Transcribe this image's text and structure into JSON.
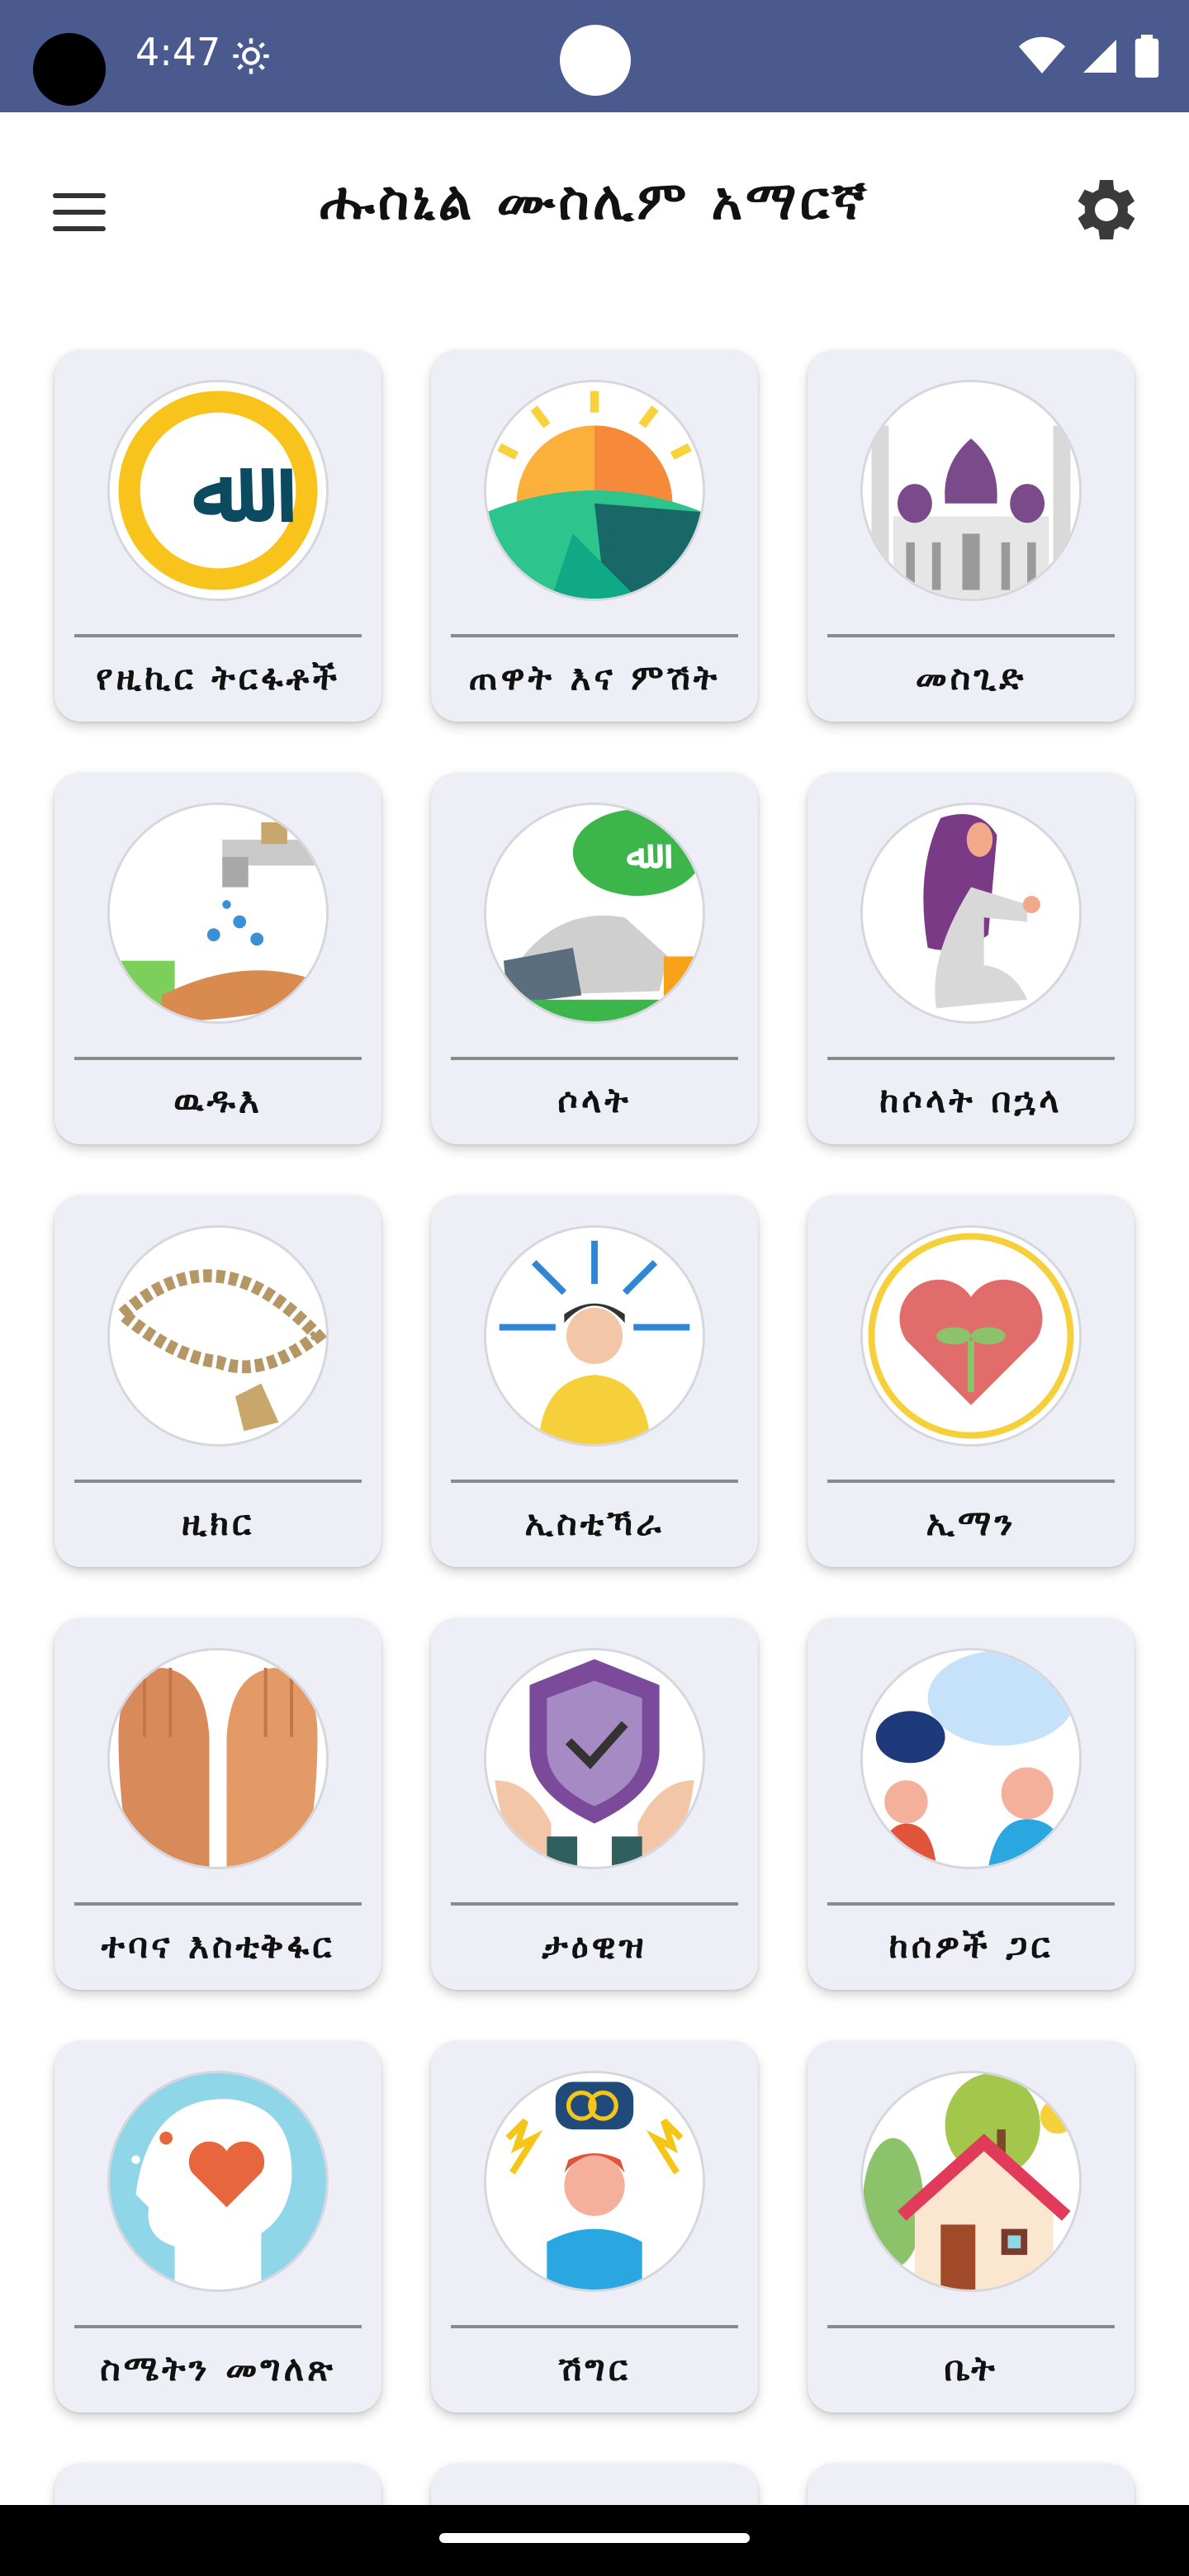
{
  "status_bar": {
    "time": "4:47",
    "colors": {
      "background": "#4a5a8f"
    },
    "icons": [
      "settings-gear-icon",
      "wifi-icon",
      "signal-icon",
      "battery-icon"
    ]
  },
  "app_bar": {
    "title": "ሑስኒል ሙስሊም አማርኛ",
    "menu_icon": "hamburger-menu-icon",
    "settings_icon": "gear-icon"
  },
  "categories": [
    {
      "label": "የዚኪር ትርፋቶች",
      "icon": "allah-calligraphy-icon"
    },
    {
      "label": "ጠዋት እና ምሽት",
      "icon": "sunrise-icon"
    },
    {
      "label": "መስጊድ",
      "icon": "mosque-icon"
    },
    {
      "label": "ዉዱእ",
      "icon": "ablution-tap-icon"
    },
    {
      "label": "ሶላት",
      "icon": "prostration-icon"
    },
    {
      "label": "ከሶላት በኋላ",
      "icon": "praying-woman-icon"
    },
    {
      "label": "ዚክር",
      "icon": "prayer-beads-icon"
    },
    {
      "label": "ኢስቲኻራ",
      "icon": "seeking-guidance-icon"
    },
    {
      "label": "ኢማን",
      "icon": "heart-sprout-icon"
    },
    {
      "label": "ተባና እስቲቅፋር",
      "icon": "raised-hands-icon"
    },
    {
      "label": "ታዕዊዝ",
      "icon": "protection-shield-icon"
    },
    {
      "label": "ከሰዎች ጋር",
      "icon": "people-talking-icon"
    },
    {
      "label": "ስሜትን መግለጽ",
      "icon": "head-heart-icon"
    },
    {
      "label": "ሽግር",
      "icon": "stressed-person-icon"
    },
    {
      "label": "ቤት",
      "icon": "house-icon"
    }
  ],
  "theme": {
    "card_background": "#eeeef6",
    "accent": "#4a5a8f"
  }
}
